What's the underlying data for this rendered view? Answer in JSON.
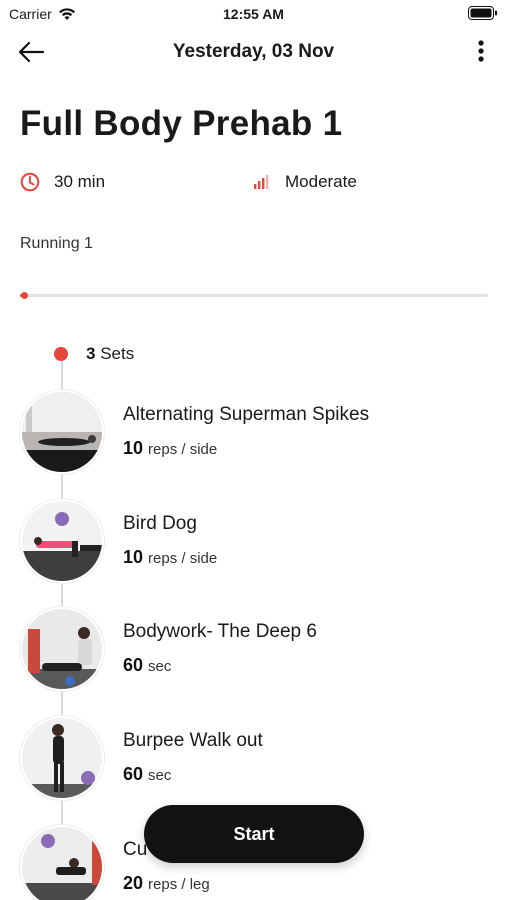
{
  "status_bar": {
    "carrier": "Carrier",
    "time": "12:55 AM"
  },
  "nav": {
    "title": "Yesterday, 03 Nov"
  },
  "workout": {
    "title": "Full Body Prehab 1",
    "duration": "30 min",
    "level": "Moderate",
    "section": "Running 1",
    "progress_fraction": 0.01
  },
  "sets": {
    "count": "3",
    "label": "Sets"
  },
  "exercises": [
    {
      "name": "Alternating Superman Spikes",
      "count": "10",
      "unit": "reps / side"
    },
    {
      "name": "Bird Dog",
      "count": "10",
      "unit": "reps / side"
    },
    {
      "name": "Bodywork- The Deep 6",
      "count": "60",
      "unit": "sec"
    },
    {
      "name": "Burpee Walk out",
      "count": "60",
      "unit": "sec"
    },
    {
      "name": "Cu",
      "count": "20",
      "unit": "reps / leg"
    }
  ],
  "start_button": {
    "label": "Start"
  },
  "colors": {
    "accent": "#e8453c",
    "button": "#121212"
  }
}
